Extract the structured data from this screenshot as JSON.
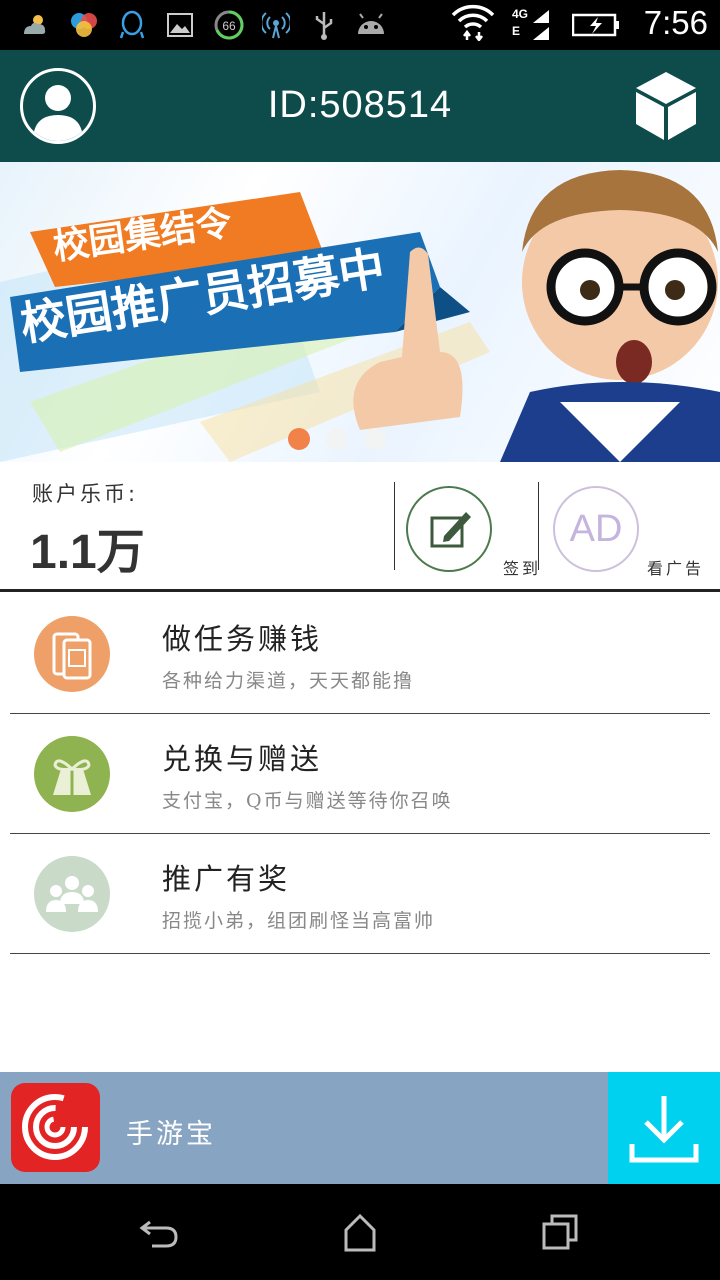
{
  "status_bar": {
    "time": "7:56",
    "battery_badge": "66",
    "network_top": "4G",
    "network_bottom": "E",
    "icons": [
      "weather-icon",
      "app-icon",
      "qq-icon",
      "image-icon",
      "battery-saver-icon",
      "hotspot-icon",
      "usb-icon",
      "android-icon",
      "wifi-icon",
      "signal-icon",
      "battery-icon"
    ]
  },
  "header": {
    "title": "ID:508514",
    "avatar_icon": "user-avatar-icon",
    "right_icon": "cube-icon",
    "background": "#0e4c4c"
  },
  "banner": {
    "line1": "校园集结令",
    "line2": "校园推广员招募中",
    "slides": 3,
    "active_slide": 0,
    "accent": "#f07b3f"
  },
  "account": {
    "label": "账户乐币:",
    "value": "1.1万",
    "checkin_label": "签到",
    "ad_icon_text": "AD",
    "ad_label": "看广告"
  },
  "menu": [
    {
      "title": "做任务赚钱",
      "subtitle": "各种给力渠道，天天都能撸",
      "icon": "phone-earn-icon",
      "color": "#efa068"
    },
    {
      "title": "兑换与赠送",
      "subtitle": "支付宝，Q币与赠送等待你召唤",
      "icon": "gift-icon",
      "color": "#8fb350"
    },
    {
      "title": "推广有奖",
      "subtitle": "招揽小弟，组团刷怪当高富帅",
      "icon": "group-icon",
      "color": "#c9dbc8"
    }
  ],
  "ad_bar": {
    "app_name": "手游宝",
    "logo_color": "#e32424",
    "download_color": "#00d1ee"
  },
  "nav": {
    "buttons": [
      "back-icon",
      "home-icon",
      "recents-icon"
    ]
  }
}
